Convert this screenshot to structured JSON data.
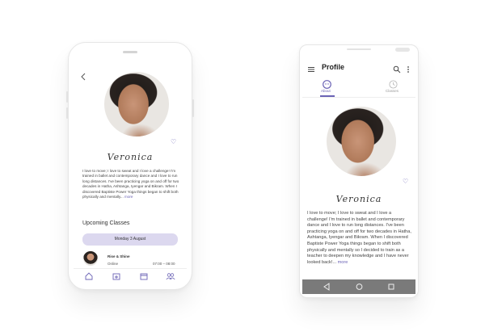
{
  "ios": {
    "profile_name": "Veronica",
    "bio_text": "I love to move; I love to sweat and I love a challenge! I'm trained in ballet and contemporary dance and I love to run long distances. I've been practicing yoga on and off for two decades in Hatha, Ashtanga, Iyengar and Bikram. When I discovered Baptiste Power Yoga things began to shift both physically and mentally...",
    "more_link": "more",
    "upcoming_title": "Upcoming Classes",
    "date_label": "Monday 3 August",
    "class": {
      "name": "Rise & Shine",
      "location": "Online",
      "time": "07:00 – 08:00"
    },
    "tab_icons": [
      "home-icon",
      "calendar-plus-icon",
      "calendar-icon",
      "community-icon"
    ]
  },
  "android": {
    "screen_title": "Profile",
    "tabs": [
      {
        "label": "About",
        "icon": "person-icon",
        "active": true
      },
      {
        "label": "Classes",
        "icon": "clock-icon",
        "active": false
      }
    ],
    "profile_name": "Veronica",
    "bio_text": "I love to move; I love to sweat and I love a challenge! I'm trained in ballet and contemporary dance and I love to run long distances. I've been practicing yoga on and off for two decades in Hatha, Ashtanga, Iyengar and Bikram. When I discovered Baptiste Power Yoga things began to shift both physically and mentally so I decided to train as a teacher to deepen my knowledge and I have never looked back!...",
    "more_link": "more"
  },
  "colors": {
    "accent": "#6b63b5",
    "pill": "#dcd8ef",
    "android_nav": "#7a7a7a"
  }
}
